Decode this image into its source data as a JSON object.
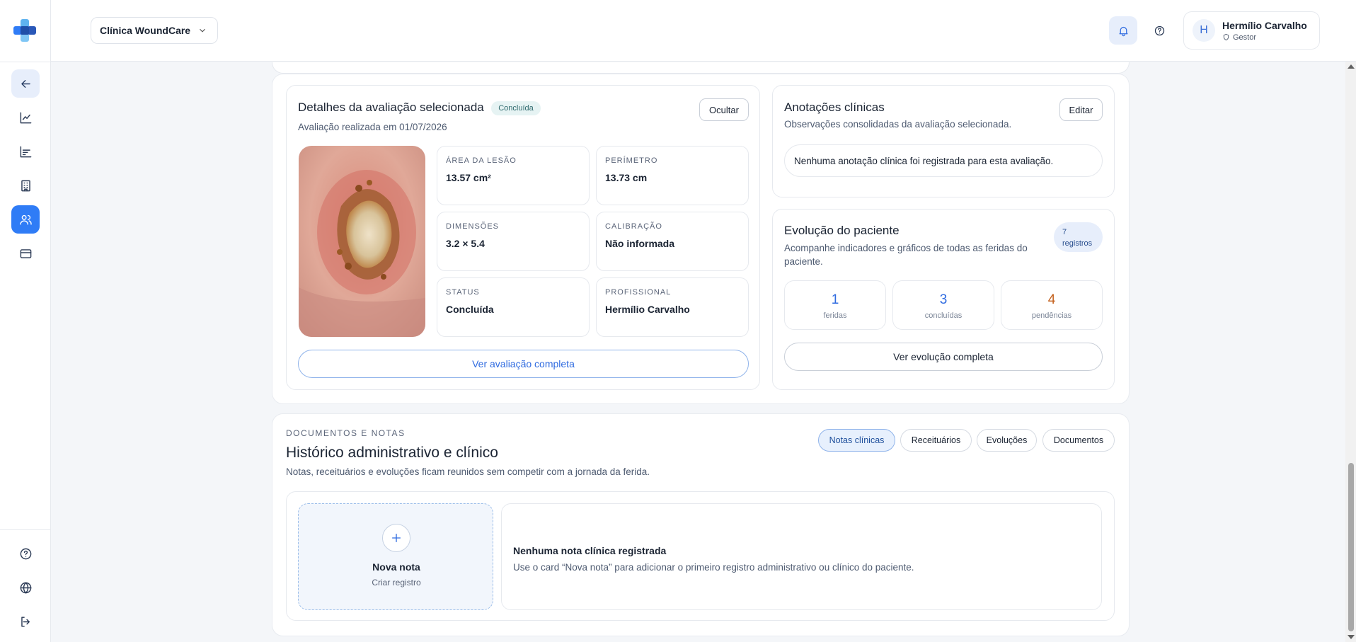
{
  "topbar": {
    "clinic": "Clínica WoundCare",
    "user": {
      "initial": "H",
      "name": "Hermílio Carvalho",
      "role": "Gestor"
    }
  },
  "sidebar": {
    "nav": [
      "back-icon",
      "chart-line-icon",
      "bar-chart-icon",
      "building-icon",
      "users-icon",
      "credit-card-icon"
    ],
    "footer": [
      "help-icon",
      "globe-icon",
      "logout-icon"
    ],
    "active": "users-icon"
  },
  "details": {
    "title": "Detalhes da avaliação selecionada",
    "badge": "Concluída",
    "hide_label": "Ocultar",
    "date_text": "Avaliação realizada em 01/07/2026",
    "metrics": [
      {
        "label": "Área da lesão",
        "value": "13.57 cm²"
      },
      {
        "label": "Perímetro",
        "value": "13.73 cm"
      },
      {
        "label": "Dimensões",
        "value": "3.2 × 5.4"
      },
      {
        "label": "Calibração",
        "value": "Não informada"
      },
      {
        "label": "Status",
        "value": "Concluída"
      },
      {
        "label": "Profissional",
        "value": "Hermílio Carvalho"
      }
    ],
    "full_button": "Ver avaliação completa"
  },
  "notes": {
    "title": "Anotações clínicas",
    "edit_label": "Editar",
    "subtitle": "Observações consolidadas da avaliação selecionada.",
    "empty_text": "Nenhuma anotação clínica foi registrada para esta avaliação."
  },
  "evolution": {
    "title": "Evolução do paciente",
    "badge_count": "7",
    "badge_label": "registros",
    "subtitle": "Acompanhe indicadores e gráficos de todas as feridas do paciente.",
    "stats": [
      {
        "value": "1",
        "label": "feridas",
        "color": "#2f6be0"
      },
      {
        "value": "3",
        "label": "concluídas",
        "color": "#2f6be0"
      },
      {
        "value": "4",
        "label": "pendências",
        "color": "#c4621f"
      }
    ],
    "full_button": "Ver evolução completa"
  },
  "docs": {
    "eyebrow": "DOCUMENTOS E NOTAS",
    "title": "Histórico administrativo e clínico",
    "subtitle": "Notas, receituários e evoluções ficam reunidos sem competir com a jornada da ferida.",
    "tabs": [
      "Notas clínicas",
      "Receituários",
      "Evoluções",
      "Documentos"
    ],
    "active_tab": "Notas clínicas",
    "new_note_title": "Nova nota",
    "new_note_sub": "Criar registro",
    "empty_title": "Nenhuma nota clínica registrada",
    "empty_text": "Use o card “Nova nota” para adicionar o primeiro registro administrativo ou clínico do paciente."
  }
}
